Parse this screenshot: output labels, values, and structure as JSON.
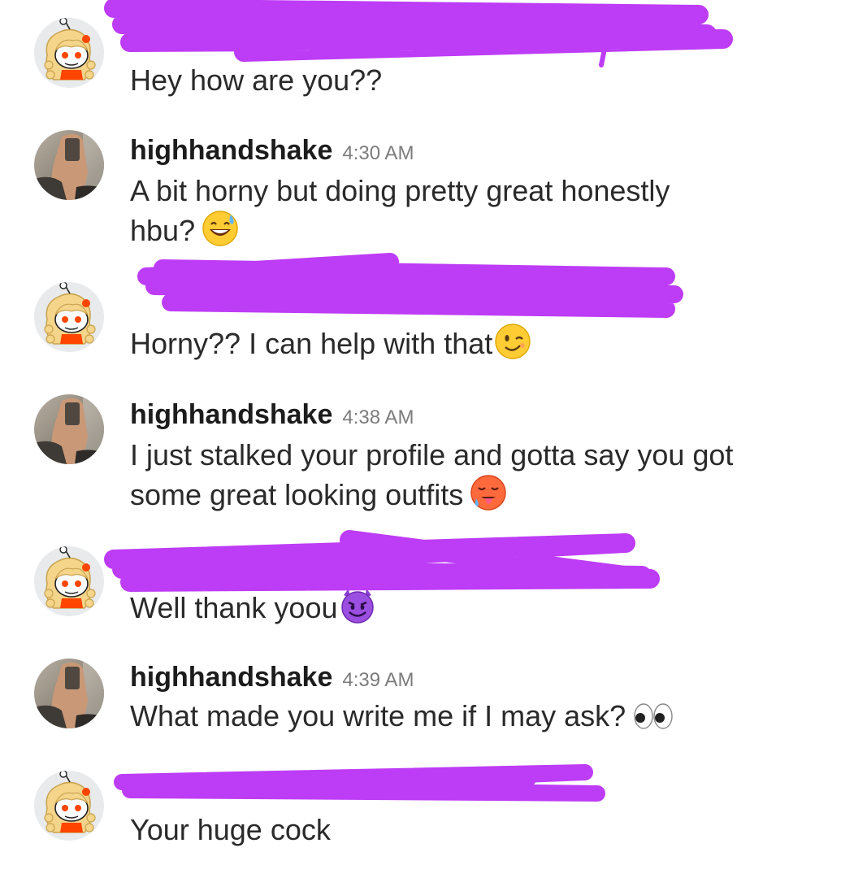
{
  "colors": {
    "redaction": "#bd3cf5",
    "username": "#1c1c1c",
    "timestamp": "#7c7c7c",
    "text": "#2a2a2a"
  },
  "messages": [
    {
      "author": "redacted",
      "avatar": "snoo-girl-avatar",
      "text": "Hey how are you??",
      "emoji": ""
    },
    {
      "author": "highhandshake",
      "time": "4:30 AM",
      "avatar": "user-photo-avatar",
      "line1": "A bit horny but doing pretty great honestly",
      "line2": "hbu?",
      "emoji": "grinning-sweat-emoji"
    },
    {
      "author": "redacted",
      "avatar": "snoo-girl-avatar",
      "text": "Horny?? I can help with that",
      "emoji": "winking-face-emoji"
    },
    {
      "author": "highhandshake",
      "time": "4:38 AM",
      "avatar": "user-photo-avatar",
      "line1": "I just stalked your profile and gotta say you got",
      "line2": "some great looking outfits",
      "emoji": "hot-face-emoji"
    },
    {
      "author": "redacted",
      "avatar": "snoo-girl-avatar",
      "text": "Well thank yoou",
      "emoji": "smiling-devil-emoji"
    },
    {
      "author": "highhandshake",
      "time": "4:39 AM",
      "avatar": "user-photo-avatar",
      "text": "What made you write me if I may ask?",
      "emoji": "eyes-emoji"
    },
    {
      "author": "redacted",
      "avatar": "snoo-girl-avatar",
      "text": "Your huge cock",
      "emoji": ""
    }
  ]
}
